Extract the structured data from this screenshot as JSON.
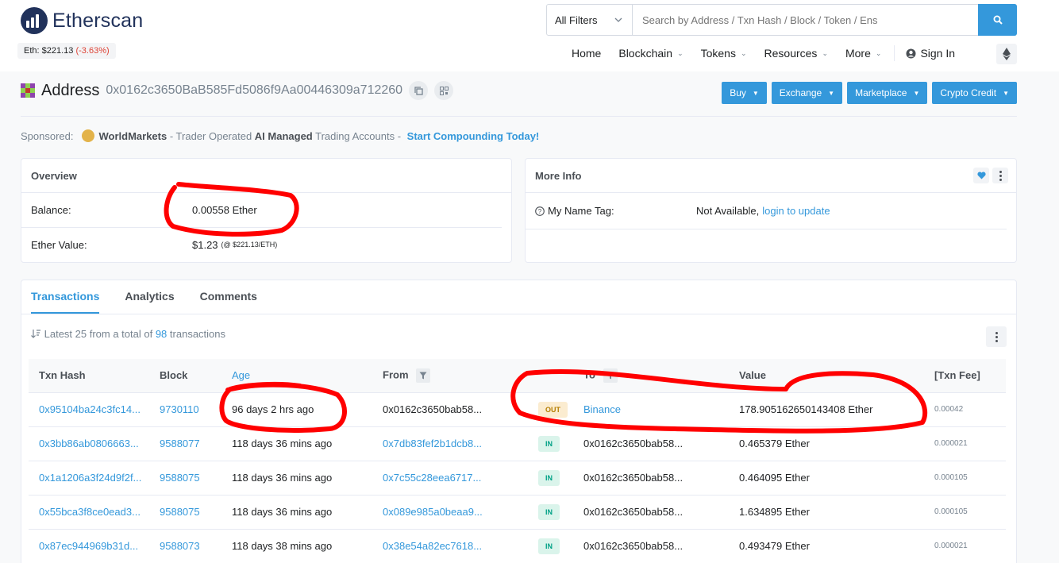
{
  "brand": {
    "name": "Etherscan",
    "price_label": "Eth: $221.13",
    "price_change": "(-3.63%)"
  },
  "search": {
    "filter_label": "All Filters",
    "placeholder": "Search by Address / Txn Hash / Block / Token / Ens"
  },
  "nav": {
    "home": "Home",
    "blockchain": "Blockchain",
    "tokens": "Tokens",
    "resources": "Resources",
    "more": "More",
    "sign_in": "Sign In"
  },
  "page": {
    "title": "Address",
    "address": "0x0162c3650BaB585Fd5086f9Aa00446309a712260"
  },
  "actions": {
    "buy": "Buy",
    "exchange": "Exchange",
    "marketplace": "Marketplace",
    "crypto_credit": "Crypto Credit"
  },
  "sponsored": {
    "label": "Sponsored:",
    "brand": "WorldMarkets",
    "text1": " - Trader Operated ",
    "bold": "AI Managed",
    "text2": " Trading Accounts - ",
    "cta": "Start Compounding Today!"
  },
  "overview": {
    "title": "Overview",
    "balance_label": "Balance:",
    "balance_value": "0.00558 Ether",
    "ether_value_label": "Ether Value:",
    "ether_value": "$1.23",
    "ether_value_rate": "(@ $221.13/ETH)"
  },
  "more_info": {
    "title": "More Info",
    "name_tag_label": "My Name Tag:",
    "name_tag_value": "Not Available,",
    "name_tag_link": "login to update"
  },
  "tabs": {
    "transactions": "Transactions",
    "analytics": "Analytics",
    "comments": "Comments"
  },
  "summary": {
    "prefix": "Latest 25 from a total of",
    "count": "98",
    "suffix": "transactions"
  },
  "table": {
    "headers": {
      "txn_hash": "Txn Hash",
      "block": "Block",
      "age": "Age",
      "from": "From",
      "to": "To",
      "value": "Value",
      "fee": "[Txn Fee]"
    },
    "rows": [
      {
        "hash": "0x95104ba24c3fc14...",
        "block": "9730110",
        "age": "96 days 2 hrs ago",
        "from": "0x0162c3650bab58...",
        "dir": "OUT",
        "to": "Binance",
        "value": "178.905162650143408 Ether",
        "fee": "0.00042"
      },
      {
        "hash": "0x3bb86ab0806663...",
        "block": "9588077",
        "age": "118 days 36 mins ago",
        "from": "0x7db83fef2b1dcb8...",
        "dir": "IN",
        "to": "0x0162c3650bab58...",
        "value": "0.465379 Ether",
        "fee": "0.000021"
      },
      {
        "hash": "0x1a1206a3f24d9f2f...",
        "block": "9588075",
        "age": "118 days 36 mins ago",
        "from": "0x7c55c28eea6717...",
        "dir": "IN",
        "to": "0x0162c3650bab58...",
        "value": "0.464095 Ether",
        "fee": "0.000105"
      },
      {
        "hash": "0x55bca3f8ce0ead3...",
        "block": "9588075",
        "age": "118 days 36 mins ago",
        "from": "0x089e985a0beaa9...",
        "dir": "IN",
        "to": "0x0162c3650bab58...",
        "value": "1.634895 Ether",
        "fee": "0.000105"
      },
      {
        "hash": "0x87ec944969b31d...",
        "block": "9588073",
        "age": "118 days 38 mins ago",
        "from": "0x38e54a82ec7618...",
        "dir": "IN",
        "to": "0x0162c3650bab58...",
        "value": "0.493479 Ether",
        "fee": "0.000021"
      }
    ]
  },
  "colors": {
    "brand_dark": "#21325b",
    "link": "#3498db",
    "annotation": "#ff0000",
    "out_badge": "#fbecd0",
    "in_badge": "#daf4eb"
  },
  "icons": {
    "search": "search-icon",
    "user": "user-icon",
    "eth": "ethereum-icon",
    "copy": "copy-icon",
    "qr": "qr-code-icon",
    "heart": "heart-icon",
    "sort": "sort-icon",
    "filter": "filter-icon",
    "question": "question-icon"
  }
}
